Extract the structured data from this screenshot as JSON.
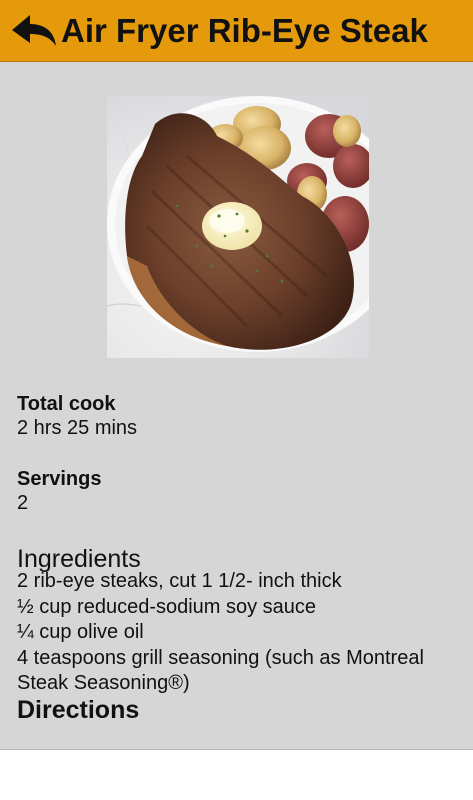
{
  "header": {
    "title": "Air Fryer Rib-Eye Steak",
    "back_icon": "back-arrow-icon",
    "background": "#e59a0c"
  },
  "photo": {
    "alt": "Air Fryer Rib-Eye Steak"
  },
  "details": {
    "total_cook_label": "Total cook",
    "total_cook_value": "2 hrs 25 mins",
    "servings_label": "Servings",
    "servings_value": "2"
  },
  "ingredients": {
    "heading": "Ingredients",
    "items": [
      "2 rib-eye steaks, cut 1 1/2- inch thick",
      "½ cup reduced-sodium soy sauce",
      "¼ cup olive oil",
      "4 teaspoons grill seasoning (such as Montreal Steak Seasoning®)"
    ]
  },
  "directions": {
    "heading": "Directions"
  },
  "colors": {
    "page_background": "#d6d6d6",
    "accent": "#e59a0c"
  }
}
